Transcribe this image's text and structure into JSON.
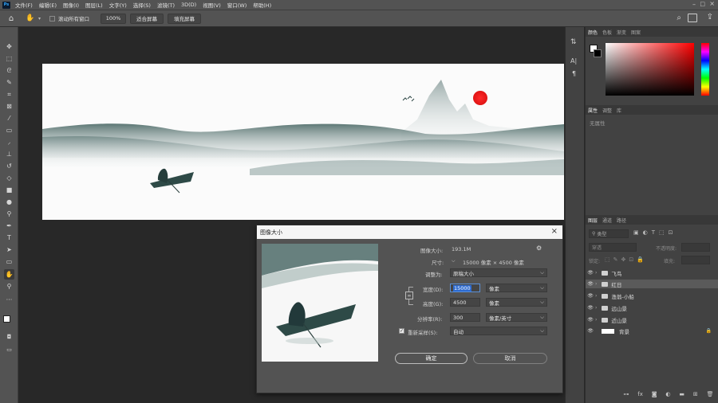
{
  "app": {
    "logo": "Ps"
  },
  "menu": [
    "文件(F)",
    "编辑(E)",
    "图像(I)",
    "图层(L)",
    "文字(Y)",
    "选择(S)",
    "滤镜(T)",
    "3D(D)",
    "视图(V)",
    "窗口(W)",
    "帮助(H)"
  ],
  "options": {
    "scroll_all": "滚动所有窗口",
    "zoom": "100%",
    "fit_screen": "适合屏幕",
    "fill_screen": "填充屏幕"
  },
  "tool_icons": [
    "move-icon",
    "marquee-icon",
    "lasso-icon",
    "quick-select-icon",
    "crop-icon",
    "frame-icon",
    "eyedropper-icon",
    "healing-icon",
    "brush-icon",
    "stamp-icon",
    "history-brush-icon",
    "eraser-icon",
    "gradient-icon",
    "blur-icon",
    "dodge-icon",
    "pen-icon",
    "type-icon",
    "path-select-icon",
    "shape-icon",
    "hand-icon",
    "zoom-icon",
    "more-icon"
  ],
  "color_panel": {
    "tabs": [
      "颜色",
      "色板",
      "渐变",
      "图案"
    ],
    "accent": "#ff0000"
  },
  "properties_panel": {
    "tabs": [
      "属性",
      "调整",
      "库"
    ],
    "empty_text": "无属性"
  },
  "layers_panel": {
    "tabs": [
      "图层",
      "通道",
      "路径"
    ],
    "kind_filter": "类型",
    "blend_mode": "穿透",
    "opacity_label": "不透明度:",
    "lock_label": "锁定:",
    "fill_label": "填充:",
    "layers": [
      {
        "name": "飞鸟",
        "type": "folder",
        "selected": false
      },
      {
        "name": "红日",
        "type": "folder",
        "selected": true
      },
      {
        "name": "渔翁-小船",
        "type": "folder",
        "selected": false
      },
      {
        "name": "远山景",
        "type": "folder",
        "selected": false
      },
      {
        "name": "近山景",
        "type": "folder",
        "selected": false
      },
      {
        "name": "背景",
        "type": "layer",
        "selected": false
      }
    ]
  },
  "dialog": {
    "title": "图像大小",
    "image_size_label": "图像大小:",
    "image_size_value": "193.1M",
    "dimensions_label": "尺寸:",
    "dimensions_value": "15000 像素  ×  4500 像素",
    "fit_to_label": "调整为:",
    "fit_to_value": "原稿大小",
    "width_label": "宽度(D):",
    "width_value": "15000",
    "width_unit": "像素",
    "height_label": "高度(G):",
    "height_value": "4500",
    "height_unit": "像素",
    "resolution_label": "分辨率(R):",
    "resolution_value": "300",
    "resolution_unit": "像素/英寸",
    "resample_label": "重新采样(S):",
    "resample_value": "自动",
    "ok": "确定",
    "cancel": "取消"
  }
}
